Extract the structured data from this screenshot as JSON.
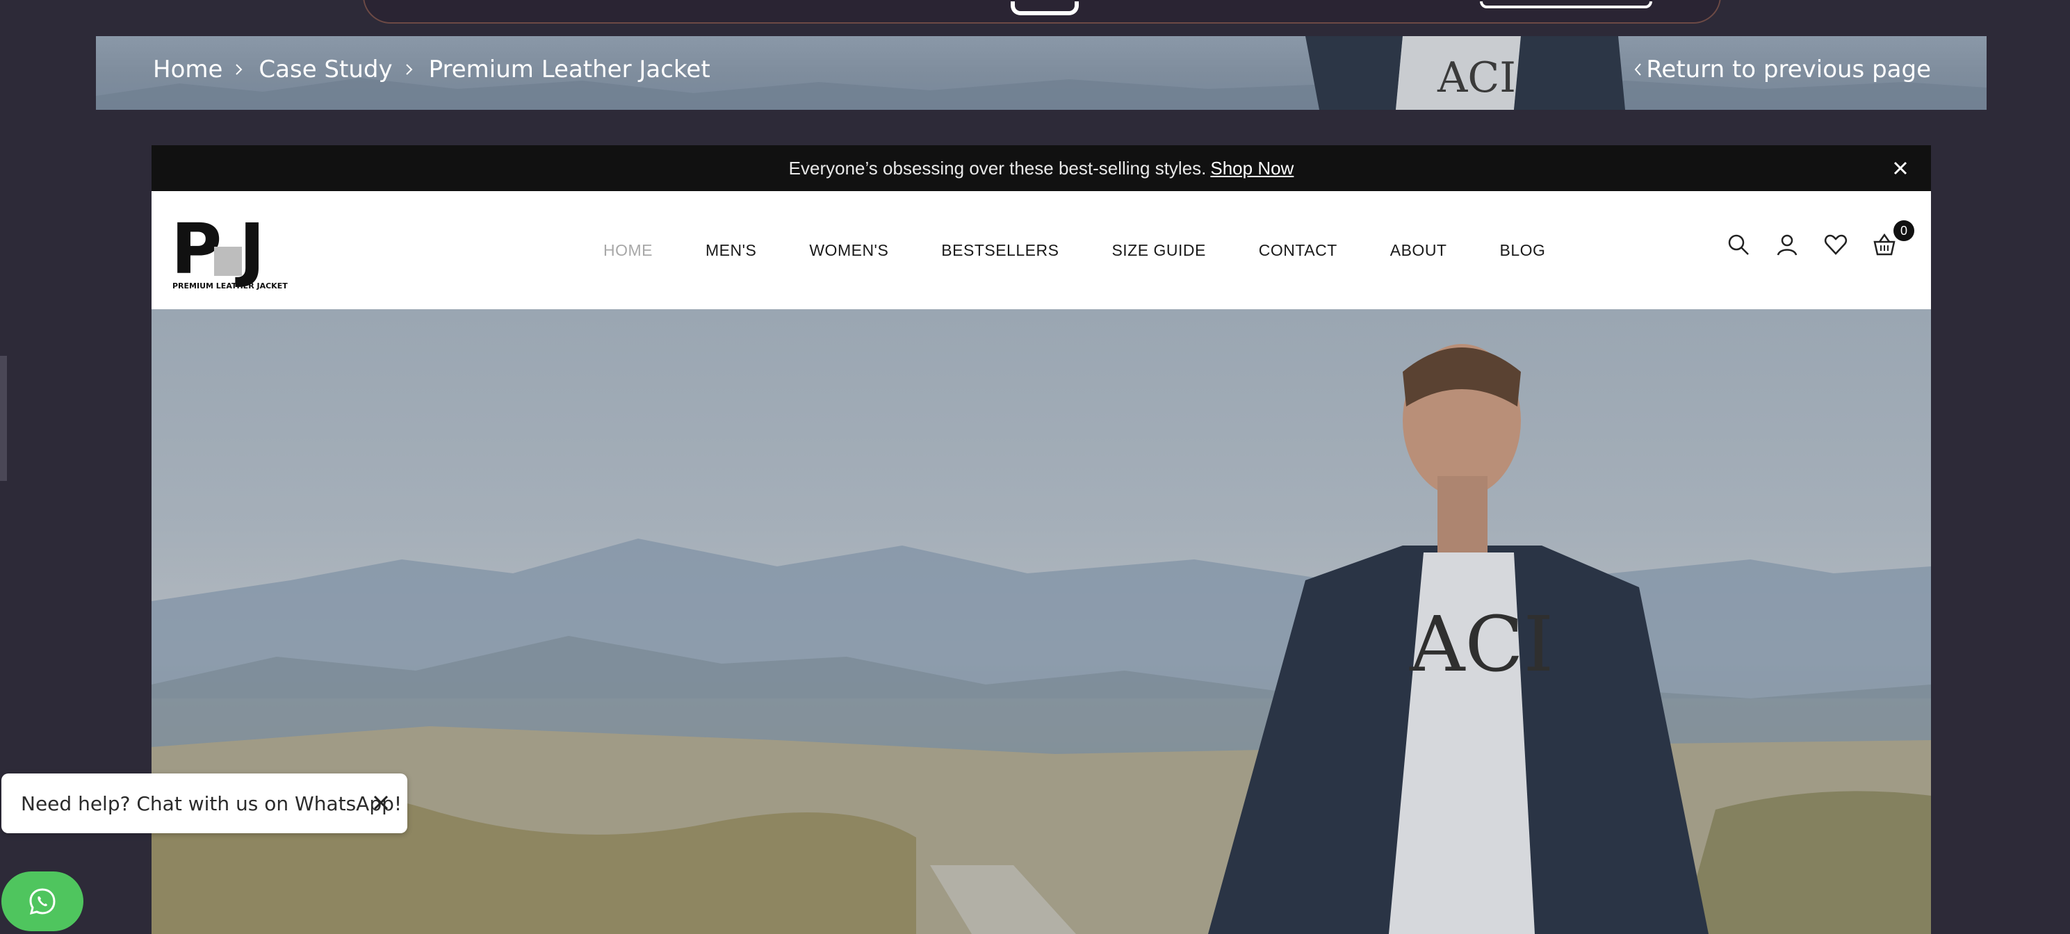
{
  "breadcrumb": {
    "items": [
      "Home",
      "Case Study",
      "Premium Leather Jacket"
    ],
    "return_label": "Return to previous page"
  },
  "announcement": {
    "text": "Everyone’s obsessing over these best-selling styles.",
    "link": "Shop Now"
  },
  "logo": {
    "letters": "PLJ",
    "tagline": "PREMIUM LEATHER JACKET"
  },
  "nav": {
    "items": [
      "HOME",
      "MEN'S",
      "WOMEN'S",
      "BESTSELLERS",
      "SIZE GUIDE",
      "CONTACT",
      "ABOUT",
      "BLOG"
    ],
    "active": "HOME"
  },
  "header_tools": {
    "icons": [
      "search-icon",
      "account-icon",
      "wishlist-icon",
      "cart-icon"
    ],
    "cart_count": "0"
  },
  "whatsapp": {
    "message": "Need help? Chat with us on WhatsApp!",
    "color": "#4fc55e"
  },
  "colors": {
    "page_bg": "#2d2a38",
    "announcement_bg": "#111111",
    "nav_active": "#a8a8a8"
  }
}
